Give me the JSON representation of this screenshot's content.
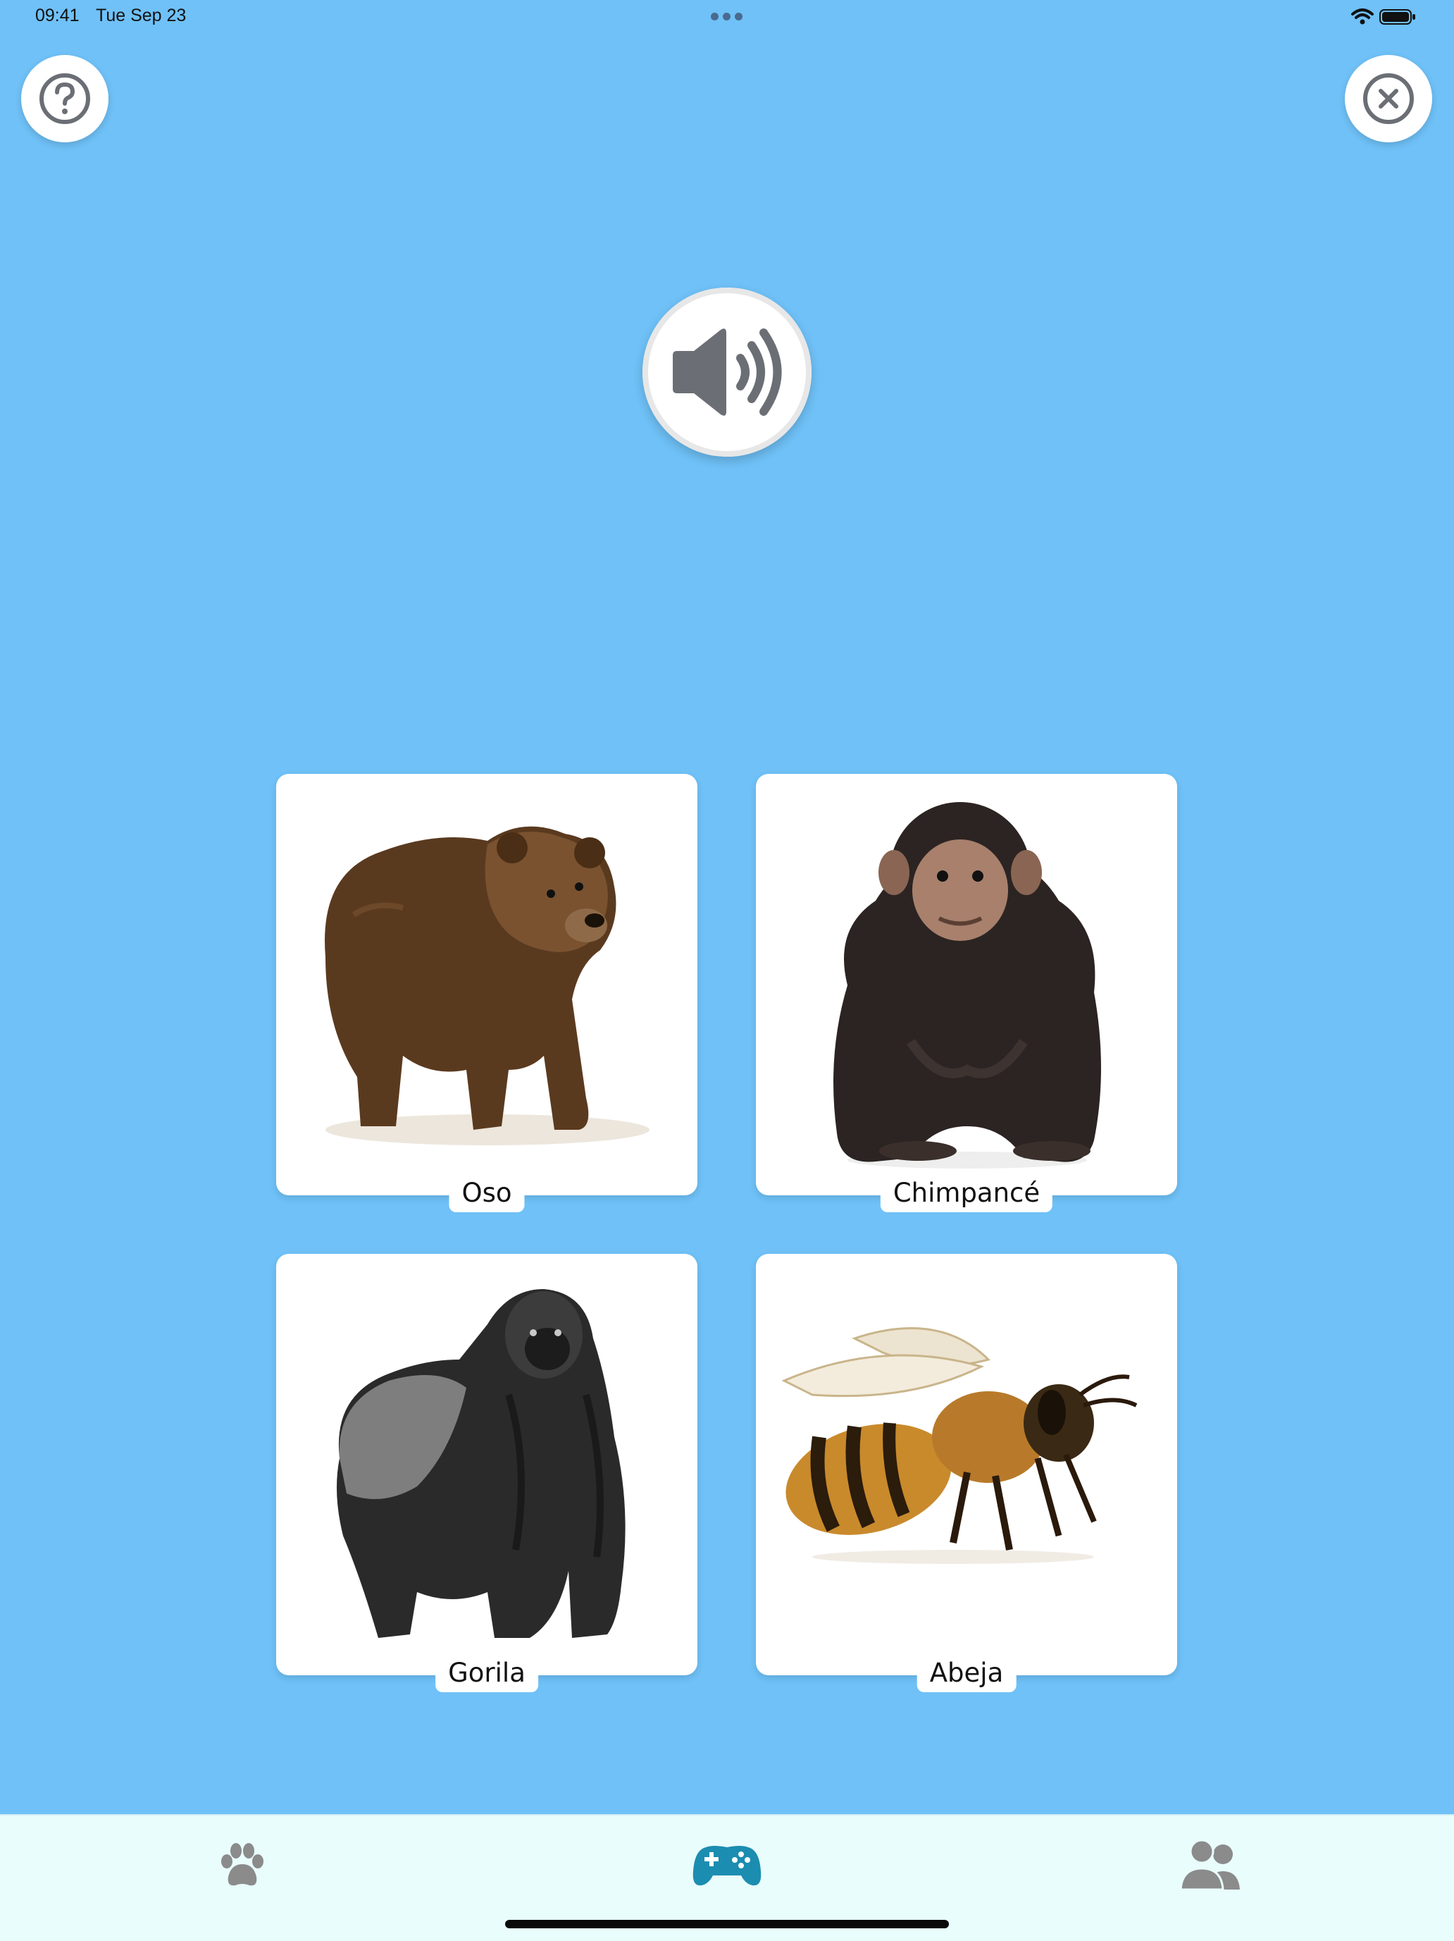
{
  "status_bar": {
    "time": "09:41",
    "date": "Tue Sep 23",
    "icons": [
      "wifi-icon",
      "battery-icon"
    ]
  },
  "header": {
    "help_icon": "question-circle-icon",
    "close_icon": "close-circle-icon"
  },
  "audio_button": {
    "icon": "speaker-volume-icon"
  },
  "cards": [
    {
      "label": "Oso",
      "image": "bear"
    },
    {
      "label": "Chimpancé",
      "image": "chimpanzee"
    },
    {
      "label": "Gorila",
      "image": "gorilla"
    },
    {
      "label": "Abeja",
      "image": "bee"
    }
  ],
  "tab_bar": {
    "items": [
      {
        "icon": "paw-icon",
        "active": false
      },
      {
        "icon": "gamepad-icon",
        "active": true
      },
      {
        "icon": "users-icon",
        "active": false
      }
    ]
  },
  "colors": {
    "background": "#6fc1f7",
    "tab_bar": "#e9fdfd",
    "active_tab": "#1b8db0",
    "inactive_tab": "#8b8b8b",
    "icon_gray": "#6b6f75"
  }
}
